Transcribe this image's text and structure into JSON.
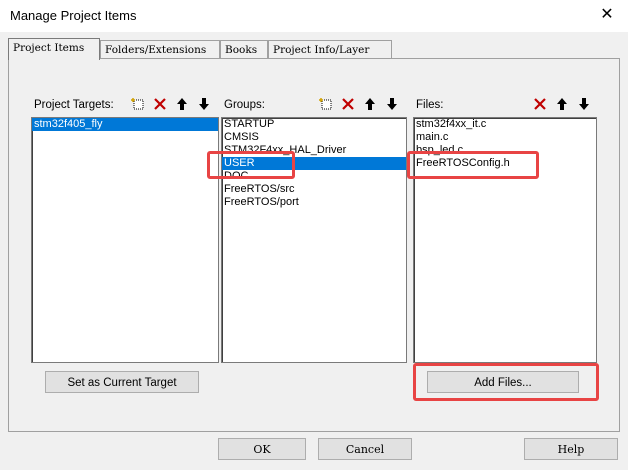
{
  "window": {
    "title": "Manage Project Items"
  },
  "tabs": [
    "Project Items",
    "Folders/Extensions",
    "Books",
    "Project Info/Layer"
  ],
  "targets": {
    "label": "Project Targets:",
    "items": [
      "stm32f405_fly"
    ],
    "set_button": "Set as Current Target"
  },
  "groups": {
    "label": "Groups:",
    "items": [
      "STARTUP",
      "CMSIS",
      "STM32F4xx_HAL_Driver",
      "USER",
      "DOC",
      "FreeRTOS/src",
      "FreeRTOS/port"
    ]
  },
  "files": {
    "label": "Files:",
    "items": [
      "stm32f4xx_it.c",
      "main.c",
      "bsp_led.c",
      "FreeRTOSConfig.h"
    ],
    "add_button": "Add Files..."
  },
  "footer": {
    "ok": "OK",
    "cancel": "Cancel",
    "help": "Help"
  },
  "colors": {
    "selection": "#0078d7",
    "highlight": "#e84444"
  }
}
